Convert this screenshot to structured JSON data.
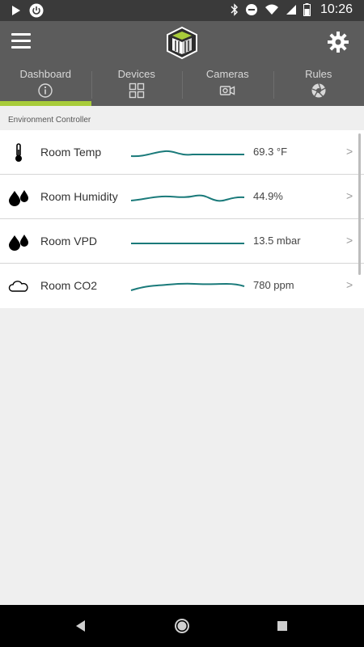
{
  "status_bar": {
    "time": "10:26"
  },
  "tabs": [
    {
      "label": "Dashboard",
      "icon": "info-icon",
      "active": true
    },
    {
      "label": "Devices",
      "icon": "grid-icon",
      "active": false
    },
    {
      "label": "Cameras",
      "icon": "camera-icon",
      "active": false
    },
    {
      "label": "Rules",
      "icon": "shutter-icon",
      "active": false
    }
  ],
  "section_label": "Environment Controller",
  "rows": [
    {
      "name": "Room Temp",
      "value": "69.3 °F",
      "icon": "thermometer-icon"
    },
    {
      "name": "Room Humidity",
      "value": "44.9%",
      "icon": "water-drops-icon"
    },
    {
      "name": "Room VPD",
      "value": "13.5 mbar",
      "icon": "water-drops-icon"
    },
    {
      "name": "Room CO2",
      "value": "780 ppm",
      "icon": "cloud-icon"
    }
  ],
  "chevron": ">",
  "colors": {
    "accent": "#a8cc3a",
    "sparkline": "#1a7a7a",
    "appbar": "#5c5c5c"
  }
}
